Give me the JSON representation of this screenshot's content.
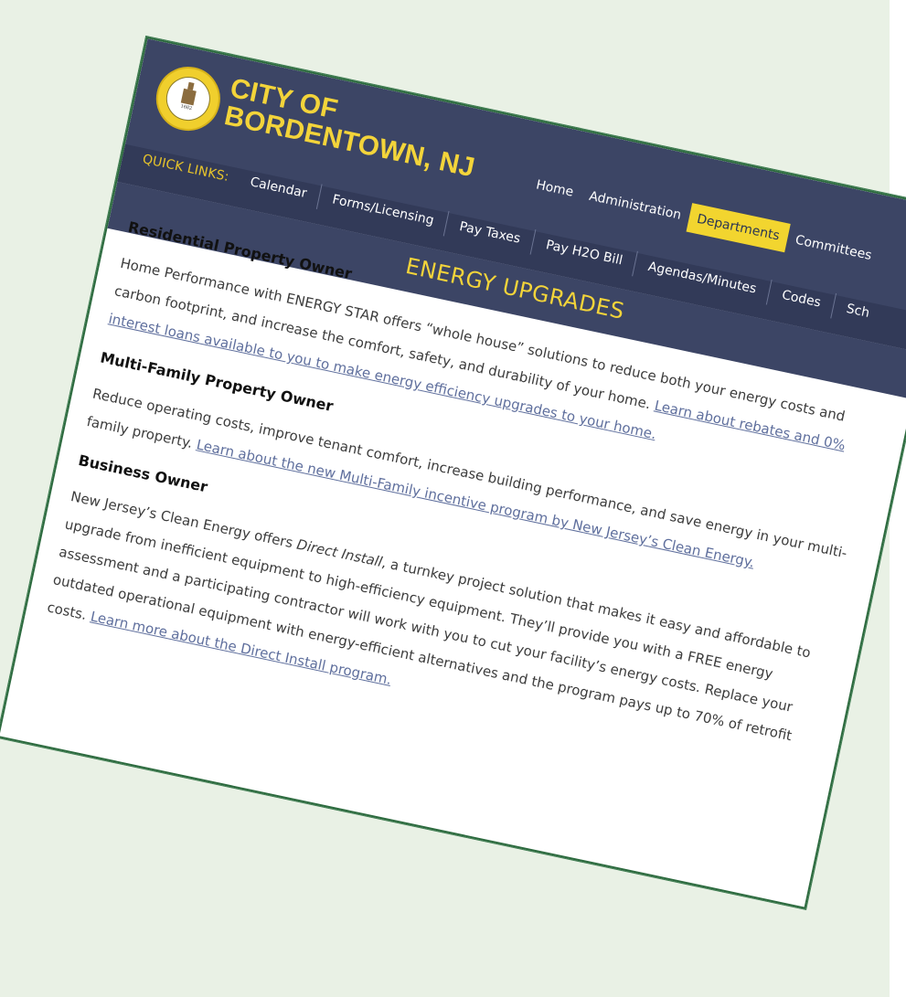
{
  "brand": {
    "line1": "CITY OF",
    "line2": "BORDENTOWN, NJ",
    "seal_text": "CITY OF BORDENTOWN N.J. FOUNDED 1682"
  },
  "main_nav": [
    "Home",
    "Administration",
    "Departments",
    "Committees"
  ],
  "main_nav_active": "Departments",
  "quick_links": {
    "label": "QUICK LINKS:",
    "items": [
      "Calendar",
      "Forms/Licensing",
      "Pay Taxes",
      "Pay H2O Bill",
      "Agendas/Minutes",
      "Codes",
      "Sch"
    ]
  },
  "page_title": "ENERGY UPGRADES",
  "sections": [
    {
      "heading": "Residential Property Owner",
      "text": "Home Performance with ENERGY STAR offers “whole house” solutions to reduce both your energy costs and carbon footprint, and increase the comfort, safety, and durability of your home. ",
      "link": "Learn about rebates and 0% interest loans available to you to make energy efficiency upgrades to your home."
    },
    {
      "heading": "Multi-Family Property Owner",
      "text": "Reduce operating costs, improve tenant comfort, increase building performance, and save energy in your multi-family property. ",
      "link": "Learn about the new Multi-Family incentive program by New Jersey’s Clean Energy."
    },
    {
      "heading": "Business Owner",
      "text_a": "New Jersey’s Clean Energy offers ",
      "emphasis": "Direct Install",
      "text_b": ", a turnkey project solution that makes it easy and affordable to upgrade from inefficient equipment to high-efficiency equipment. They’ll provide you with a FREE energy assessment and a participating contractor will work with you to cut your facility’s energy costs. Replace your outdated operational equipment with energy-efficient alternatives and the program pays up to 70% of retrofit costs. ",
      "link": "Learn more about the Direct Install program."
    }
  ],
  "colors": {
    "background": "#e9f1e5",
    "header": "#3c4565",
    "accent_yellow": "#f3d43a",
    "link": "#5f6f9d",
    "card_border": "#2c6a3e"
  }
}
